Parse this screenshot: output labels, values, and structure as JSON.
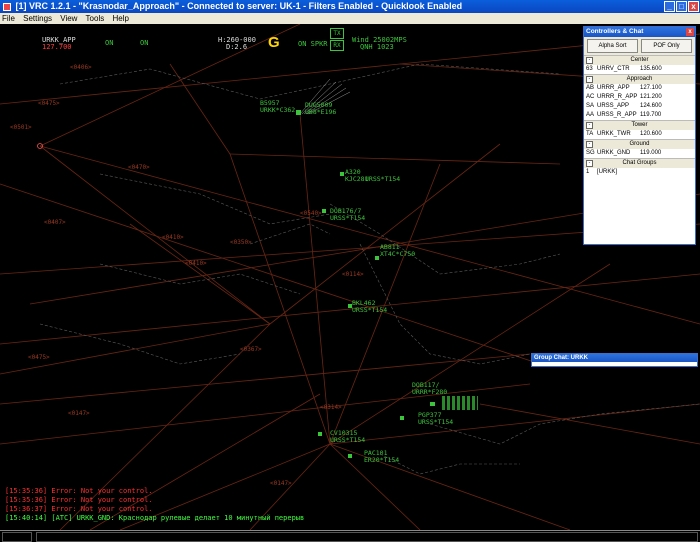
{
  "window": {
    "title": "[1] VRC 1.2.1 - \"Krasnodar_Approach\" - Connected to server: UK-1 - Filters Enabled - Quicklook Enabled",
    "min": "_",
    "max": "□",
    "close": "x"
  },
  "menu": [
    "File",
    "Settings",
    "View",
    "Tools",
    "Help"
  ],
  "hud": {
    "position": "URKK_APP",
    "frequency": "127.700",
    "on1": "ON",
    "on2": "ON",
    "heading": "H:260-000",
    "distance": "D:2.6",
    "atis": "G",
    "spkr": "ON SPKR",
    "tx": "TX",
    "rx": "RX",
    "wind": "Wind 25002MPS",
    "qnh": "QNH 1023"
  },
  "targets": [
    {
      "callsign": "B5957",
      "data": "URKK*C362"
    },
    {
      "callsign": "DUG5009",
      "data": "UB8*E196"
    },
    {
      "callsign": "A320",
      "data": "KJC281"
    },
    {
      "callsign": "",
      "data": "URSS*T154"
    },
    {
      "callsign": "DOB176/7",
      "data": "URSS*T154"
    },
    {
      "callsign": "AB811",
      "data": "XT4C*C750"
    },
    {
      "callsign": "BKL462",
      "data": "URSS*T154"
    },
    {
      "callsign": "DOB117/",
      "data": "URRR*F280"
    },
    {
      "callsign": "PGP377",
      "data": "URSS*T154"
    },
    {
      "callsign": "CV10315",
      "data": "URSS*T154"
    },
    {
      "callsign": "PAC101",
      "data": "ER20*T154"
    }
  ],
  "fixes": [
    "<0406>",
    "<0501>",
    "<0475>",
    "<0470>",
    "<0410>",
    "<0410>",
    "<0540>",
    "<0114>",
    "<0147>",
    "<0147>",
    "<0314>",
    "<0350>",
    "<0367>",
    "<0407>",
    "<0475>"
  ],
  "chat": [
    {
      "text": "[15:35:36] Error: Not your control.",
      "color": "#ff3030"
    },
    {
      "text": "[15:35:36] Error: Not your control.",
      "color": "#ff3030"
    },
    {
      "text": "[15:36:37] Error: Not your control.",
      "color": "#ff3030"
    },
    {
      "text": "[15:40:14] [ATC] URKK_GND: Краснодар рулевые делает 10 минутный перерыв",
      "color": "#40ff40"
    }
  ],
  "controllers": {
    "title": "Controllers & Chat",
    "close": "x",
    "btn_alpha": "Alpha Sort",
    "btn_pof": "POF Only",
    "groups": [
      {
        "name": "Center",
        "toggle": "-",
        "rows": [
          {
            "id": "63",
            "callsign": "URRV_CTR",
            "freq": "135.600"
          }
        ]
      },
      {
        "name": "Approach",
        "toggle": "-",
        "rows": [
          {
            "id": "AB",
            "callsign": "URRR_APP",
            "freq": "127.100"
          },
          {
            "id": "AC",
            "callsign": "URRR_R_APP",
            "freq": "121.200"
          },
          {
            "id": "SA",
            "callsign": "URSS_APP",
            "freq": "124.600"
          },
          {
            "id": "AA",
            "callsign": "URSS_R_APP",
            "freq": "119.700"
          }
        ]
      },
      {
        "name": "Tower",
        "toggle": "-",
        "rows": [
          {
            "id": "TA",
            "callsign": "URKK_TWR",
            "freq": "120.600"
          }
        ]
      },
      {
        "name": "Ground",
        "toggle": "-",
        "rows": [
          {
            "id": "SG",
            "callsign": "URKK_GND",
            "freq": "119.000"
          }
        ]
      },
      {
        "name": "Chat Groups",
        "toggle": "-",
        "rows": [
          {
            "id": "1",
            "callsign": "[URKK]",
            "freq": ""
          }
        ]
      }
    ]
  },
  "groupchat": {
    "title": "Group Chat: URKK"
  },
  "colors": {
    "route": "#7a2a1a",
    "target": "#3cc43c",
    "text_green": "#3cc43c",
    "atis": "#ffd400"
  }
}
